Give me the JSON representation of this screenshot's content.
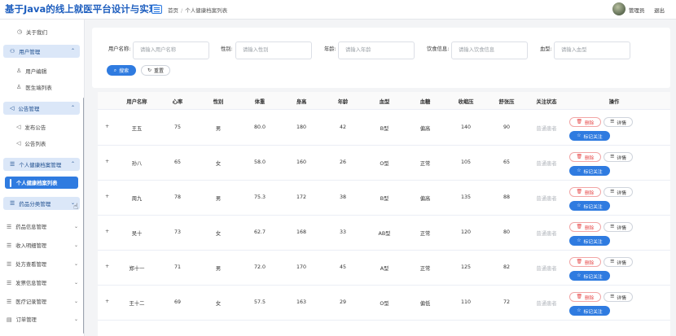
{
  "header": {
    "title": "基于Java的线上就医平台设计与实现",
    "breadcrumb": [
      "首页",
      "个人健康档案列表"
    ],
    "user": "管理员",
    "logout": "退出"
  },
  "sidebar": {
    "about": "关于我们",
    "user_mgmt": "用户管理",
    "user_edit": "用户编辑",
    "doctor_list": "医生端列表",
    "notice_mgmt": "公告管理",
    "publish_notice": "发布公告",
    "notice_list": "公告列表",
    "health_mgmt": "个人健康档案管理",
    "health_list": "个人健康档案列表",
    "drug_category": "药品分类管理",
    "drug_info": "药品信息管理",
    "income": "收入明细管理",
    "prescription": "处方查看管理",
    "invoice": "发票信息管理",
    "medical_record": "医疗记录管理",
    "orders": "订单管理"
  },
  "search": {
    "fields": [
      {
        "label": "用户名称:",
        "placeholder": "请输入用户名称"
      },
      {
        "label": "性别:",
        "placeholder": "请输入性别"
      },
      {
        "label": "年龄:",
        "placeholder": "请输入年龄"
      },
      {
        "label": "饮食信息:",
        "placeholder": "请输入饮食信息"
      },
      {
        "label": "血型:",
        "placeholder": "请输入血型"
      }
    ],
    "search_btn": "搜索",
    "reset_btn": "重置"
  },
  "table": {
    "columns": [
      "用户名称",
      "心率",
      "性别",
      "体重",
      "身高",
      "年龄",
      "血型",
      "血糖",
      "收缩压",
      "舒张压",
      "关注状态",
      "操作"
    ],
    "rows": [
      {
        "name": "王五",
        "hr": "75",
        "sex": "男",
        "weight": "80.0",
        "height": "180",
        "age": "42",
        "blood": "B型",
        "sugar": "偏高",
        "sys": "140",
        "dia": "90",
        "status": "普通患者"
      },
      {
        "name": "孙八",
        "hr": "65",
        "sex": "女",
        "weight": "58.0",
        "height": "160",
        "age": "26",
        "blood": "O型",
        "sugar": "正常",
        "sys": "105",
        "dia": "65",
        "status": "普通患者"
      },
      {
        "name": "周九",
        "hr": "78",
        "sex": "男",
        "weight": "75.3",
        "height": "172",
        "age": "38",
        "blood": "B型",
        "sugar": "偏高",
        "sys": "135",
        "dia": "88",
        "status": "普通患者"
      },
      {
        "name": "吴十",
        "hr": "73",
        "sex": "女",
        "weight": "62.7",
        "height": "168",
        "age": "33",
        "blood": "AB型",
        "sugar": "正常",
        "sys": "120",
        "dia": "80",
        "status": "普通患者"
      },
      {
        "name": "郑十一",
        "hr": "71",
        "sex": "男",
        "weight": "72.0",
        "height": "170",
        "age": "45",
        "blood": "A型",
        "sugar": "正常",
        "sys": "125",
        "dia": "82",
        "status": "普通患者"
      },
      {
        "name": "王十二",
        "hr": "69",
        "sex": "女",
        "weight": "57.5",
        "height": "163",
        "age": "29",
        "blood": "O型",
        "sugar": "偏低",
        "sys": "110",
        "dia": "72",
        "status": "普通患者"
      }
    ],
    "actions": {
      "delete": "删除",
      "detail": "详情",
      "mark": "标记关注"
    },
    "expand_glyph": "+"
  },
  "colors": {
    "primary": "#2f7be0",
    "danger": "#e54545",
    "header_title": "#1f5fbf"
  }
}
